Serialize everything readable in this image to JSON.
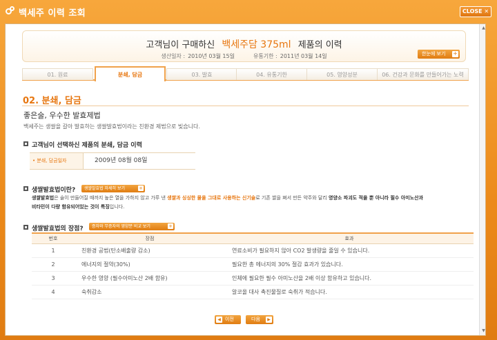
{
  "window": {
    "title": "백세주 이력 조회",
    "close_label": "CLOSE ✕",
    "accent": "#e7760f"
  },
  "header": {
    "title_prefix": "고객님이 구매하신",
    "product": "백세주담 375ml",
    "title_suffix": "제품의 이력",
    "production_label": "생산일자 :",
    "production_date": "2010년 03월 15일",
    "expiry_label": "유통기한 :",
    "expiry_date": "2011년 03월 14일",
    "view_all_label": "한눈에 보기"
  },
  "tabs": [
    {
      "label": "01. 원료",
      "active": false
    },
    {
      "label": "분쇄, 담금",
      "active": true
    },
    {
      "label": "03. 발효",
      "active": false
    },
    {
      "label": "04. 유통기한",
      "active": false
    },
    {
      "label": "05. 영양성분",
      "active": false
    },
    {
      "label": "06. 건강과 문화를 만들어가는 노력",
      "active": false
    }
  ],
  "section": {
    "title": "02. 분쇄, 담금",
    "subtitle": "좋은술, 우수한 발효제법",
    "description": "백세주는 생쌀을 갈아 발효하는 생쌀발효법이라는 친환경 제법으로 빚습니다."
  },
  "history": {
    "heading": "고객님이 선택하신 제품의 분쇄, 담금 이력",
    "label": "• 분쇄, 담금일자",
    "value": "2009년 08월 08일"
  },
  "method": {
    "heading": "생쌀발효법이란?",
    "detail_button": "생쌀발효법 자세히 보기",
    "p1": "생쌀발효법",
    "p2": "은 술이 만들어질 때까지 높은 열을 가하지 않고 가루 낸 ",
    "p3": "생쌀과 싱싱한 물을 그대로 사용하는 신기술",
    "p4": "로 기존 쌀을 쪄서 만든 약주와 달리 ",
    "p5": "영양소 파괴도 적을 뿐 아니라 필수 아미노산과",
    "p6": "비타민이 다량 함유되어있는 것이 특징",
    "p7": "입니다."
  },
  "merits": {
    "heading": "생쌀발효법의 장점?",
    "compare_button": "증자와 무증자의 영양분 비교 보기",
    "columns": [
      "번호",
      "장점",
      "효과"
    ],
    "rows": [
      {
        "num": "1",
        "merit": "친환경 공법(탄소배출량 감소)",
        "effect": "연료소비가 필요하지 않아 CO2 발생량을 줄일 수 있습니다."
      },
      {
        "num": "2",
        "merit": "에너지의 절약(30%)",
        "effect": "필요한 총 에너지의 30% 절감 효과가 있습니다."
      },
      {
        "num": "3",
        "merit": "우수한 영양 (필수아미노산 2배 함유)",
        "effect": "인체에 필요한 필수 아미노산을 2배 이상 함유하고 있습니다."
      },
      {
        "num": "4",
        "merit": "숙취감소",
        "effect": "알코올 대사 촉진물질로 숙취가 적습니다."
      }
    ]
  },
  "nav": {
    "prev_label": "이전",
    "next_label": "다음"
  }
}
